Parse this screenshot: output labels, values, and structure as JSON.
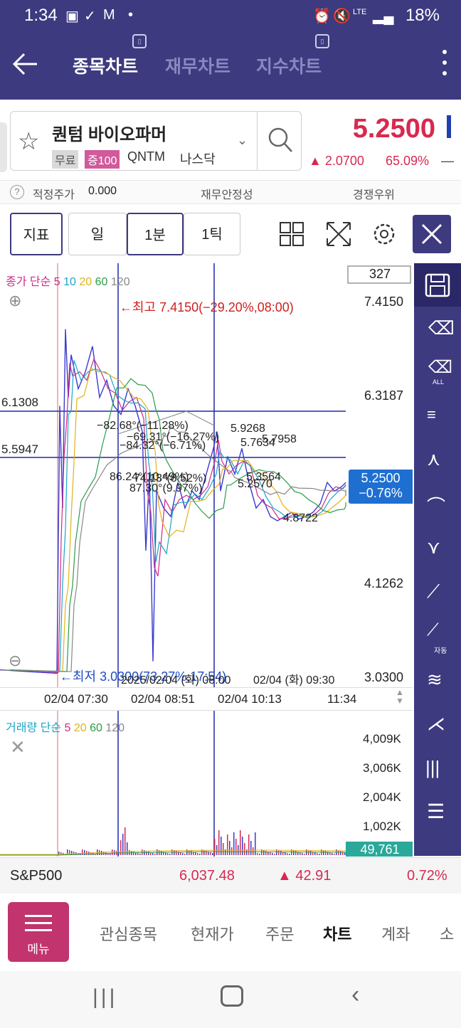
{
  "status": {
    "time": "1:34",
    "battery": "18%",
    "net": "LTE"
  },
  "header": {
    "tabs": [
      "종목차트",
      "재무차트",
      "지수차트"
    ],
    "active_tab": 0
  },
  "stock": {
    "name": "퀀텀 바이오파머",
    "market_chip": "무료",
    "margin_chip": "증100",
    "code": "QNTM",
    "exchange": "나스닥",
    "price": "5.2500",
    "change": "▲ 2.0700",
    "change_pct": "65.09%",
    "dash": "—"
  },
  "info": {
    "fair_price_label": "적정주가",
    "fair_price_value": "0.000",
    "fin_label": "재무안정성",
    "comp_label": "경쟁우위",
    "help": "?"
  },
  "toolbar": {
    "indicator": "지표",
    "day": "일",
    "minute": "1분",
    "tick": "1틱"
  },
  "chart": {
    "legend_prefix": "종가 단순",
    "ma": [
      "5",
      "10",
      "20",
      "60",
      "120"
    ],
    "ma_colors": [
      "#d12a86",
      "#1aa5c9",
      "#e0b21a",
      "#2a9c4a",
      "#888888"
    ],
    "count_box": "327",
    "price_ticks": [
      "7.4150",
      "6.3187",
      "4.1262",
      "3.0300"
    ],
    "hline_labels": [
      "6.1308",
      "5.5947"
    ],
    "high_note": "최고 7.4150(−29.20%,08:00)",
    "low_note": "최저 3.0300(73.27%,17:54)",
    "current_price": "5.2500",
    "current_pct": "−0.76%",
    "annotations": [
      "−82.68°(−11.28%)",
      "−69.31°(−16.27%)",
      "−84.32°(−6.71%)",
      "5.9268",
      "5.7634",
      "5.7958",
      "86.24°(10.49%)",
      "74.13°(8.52%)",
      "87.30°(9.97%)",
      "5.3564",
      "5.2570",
      "4.8722"
    ],
    "date_note": "2025/02/04 (화) 08:00",
    "date_note2": "02/04 (화) 09:30",
    "time_labels": [
      "02/04 07:30",
      "02/04 08:51",
      "02/04 10:13",
      "11:34"
    ]
  },
  "volume": {
    "legend_prefix": "거래량 단순",
    "ma": [
      "5",
      "20",
      "60",
      "120"
    ],
    "ticks": [
      "4,009K",
      "3,006K",
      "2,004K",
      "1,002K"
    ],
    "current": "49,761"
  },
  "right_tools": [
    "save-icon",
    "eraser-icon",
    "eraser-all-icon",
    "hcl-icon",
    "cross-up-icon",
    "cross-flat-icon",
    "cross-down-icon",
    "trend-line-icon",
    "auto-trend-icon",
    "fan-icon",
    "fan-lines-icon",
    "vertical-lines-icon",
    "horizontal-lines-icon"
  ],
  "right_tool_labels": {
    "eraser_all": "ALL",
    "auto": "자동"
  },
  "index": {
    "name": "S&P500",
    "value": "6,037.48",
    "change": "▲ 42.91",
    "pct": "0.72%"
  },
  "bottom_nav": {
    "menu": "메뉴",
    "items": [
      "관심종목",
      "현재가",
      "주문",
      "차트",
      "계좌",
      "소"
    ],
    "active": 3
  }
}
